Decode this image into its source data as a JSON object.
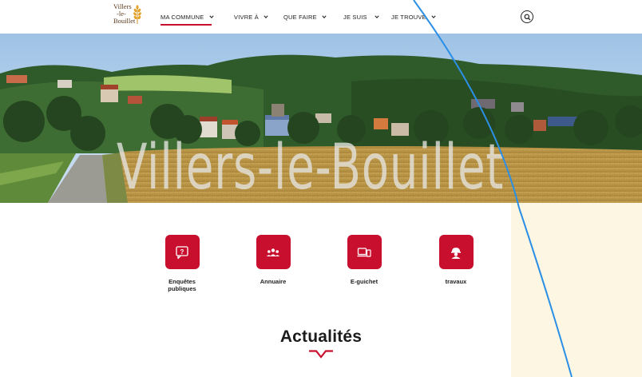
{
  "logo": {
    "line1": "Villers",
    "line2": "-le-",
    "line3": "Bouillet"
  },
  "nav": {
    "items": [
      {
        "label": "MA COMMUNE",
        "active": true
      },
      {
        "label": "VIVRE À",
        "active": false
      },
      {
        "label": "QUE FAIRE",
        "active": false
      },
      {
        "label": "JE SUIS",
        "active": false
      },
      {
        "label": "JE TROUVE",
        "active": false
      }
    ]
  },
  "hero": {
    "title": "Villers-le-Bouillet"
  },
  "quick_links": [
    {
      "label": "Enquêtes publiques",
      "icon": "question-bubble-icon"
    },
    {
      "label": "Annuaire",
      "icon": "people-group-icon"
    },
    {
      "label": "E-guichet",
      "icon": "devices-icon"
    },
    {
      "label": "travaux",
      "icon": "worker-helmet-icon"
    }
  ],
  "news": {
    "title": "Actualités"
  },
  "colors": {
    "accent": "#c8102e",
    "curve": "#2b8fe6",
    "panel": "#fdf6e3"
  }
}
